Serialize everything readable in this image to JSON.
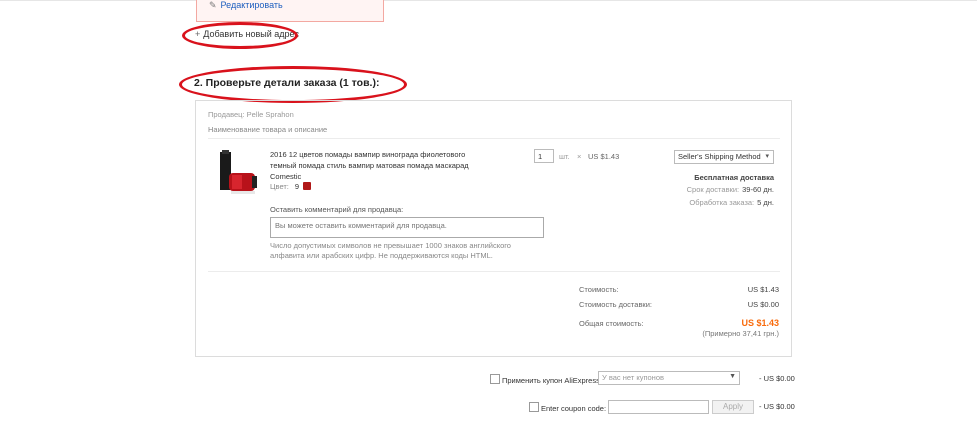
{
  "address": {
    "edit_label": "Редактировать",
    "add_new_label": "Добавить новый адрес"
  },
  "section": {
    "title": "2. Проверьте детали заказа (1 тов.):"
  },
  "order": {
    "seller_label": "Продавец: Pelle Sprahon",
    "column_header": "Наименование товара и описание",
    "product": {
      "title": "2016 12 цветов помады вампир винограда фиолетового темный помада стиль вампир матовая помада маскарад Comestic",
      "color_label": "Цвет:",
      "color_value": "9",
      "quantity": "1",
      "unit": "шт.",
      "times": "×",
      "unit_price": "US $1.43"
    },
    "shipping": {
      "method": "Seller's Shipping Method",
      "free_label": "Бесплатная доставка",
      "delivery_label": "Срок доставки:",
      "delivery_value": "39-60 дн.",
      "processing_label": "Обработка заказа:",
      "processing_value": "5 дн."
    },
    "comment": {
      "label": "Оставить комментарий для продавца:",
      "placeholder": "Вы можете оставить комментарий для продавца.",
      "hint": "Число допустимых символов не превышает 1000 знаков английского алфавита или арабских цифр. Не поддерживаются коды HTML."
    },
    "summary": {
      "cost_label": "Стоимость:",
      "cost_value": "US $1.43",
      "shipping_label": "Стоимость доставки:",
      "shipping_value": "US $0.00",
      "total_label": "Общая стоимость:",
      "total_value": "US $1.43",
      "total_approx": "(Примерно 37,41 грн.)"
    }
  },
  "coupons": {
    "aliexpress_label": "Применить купон AliExpress:",
    "aliexpress_select": "У вас нет купонов",
    "aliexpress_amount": "- US $0.00",
    "code_label": "Enter coupon code:",
    "apply_label": "Apply",
    "code_amount": "- US $0.00"
  },
  "colors": {
    "highlight": "#d9121c",
    "link": "#1f5fbf",
    "total": "#f96b0c"
  }
}
